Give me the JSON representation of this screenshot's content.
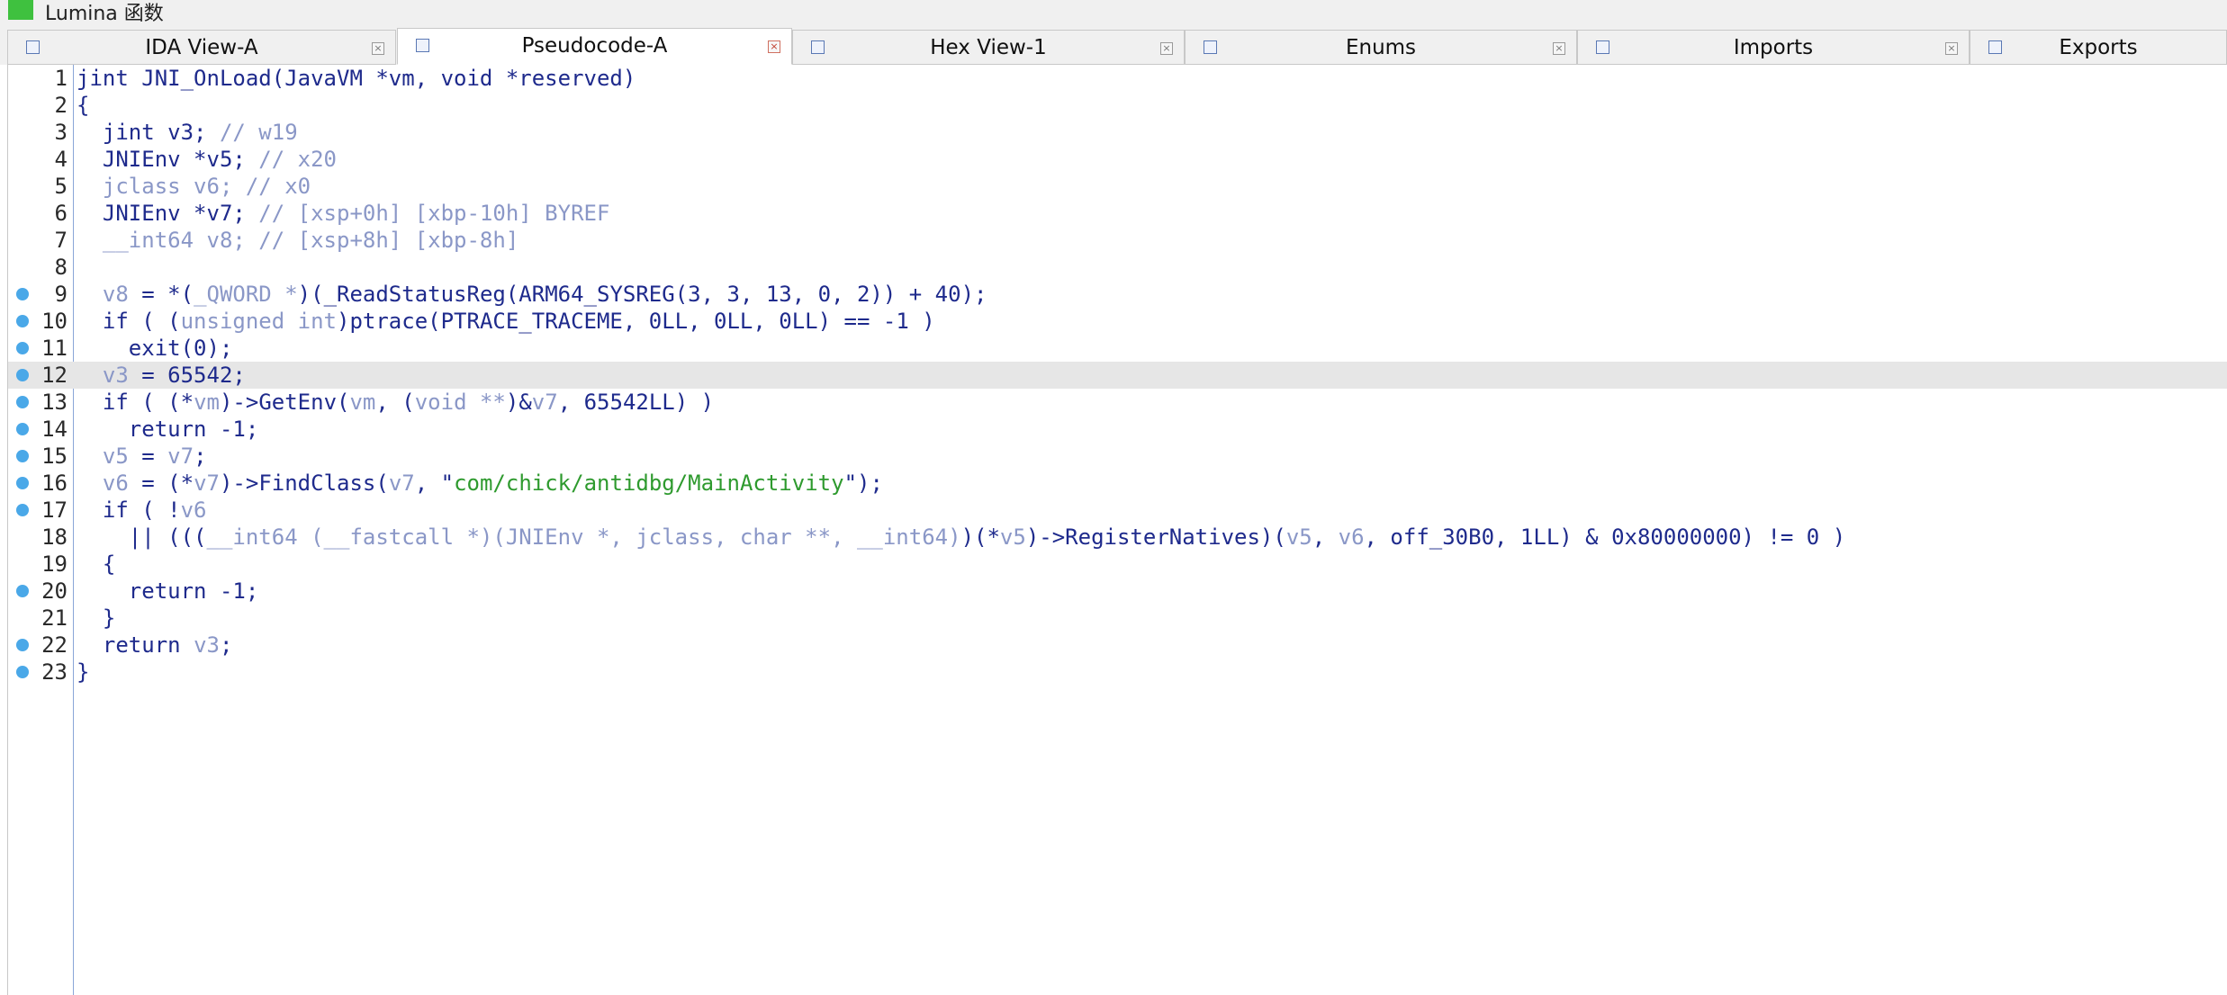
{
  "window": {
    "title": "Lumina 函数",
    "accent": "#3fc13f"
  },
  "tabs": [
    {
      "label": "IDA View-A",
      "icon": "ida-view-icon",
      "active": false
    },
    {
      "label": "Pseudocode-A",
      "icon": "pseudocode-icon",
      "active": true
    },
    {
      "label": "Hex View-1",
      "icon": "hex-view-icon",
      "active": false
    },
    {
      "label": "Enums",
      "icon": "enums-icon",
      "active": false
    },
    {
      "label": "Imports",
      "icon": "imports-icon",
      "active": false
    },
    {
      "label": "Exports",
      "icon": "exports-icon",
      "active": false
    }
  ],
  "close_glyph": "×",
  "editor": {
    "highlighted_line": 12,
    "lines": [
      {
        "n": "1",
        "bp": false,
        "indent": "",
        "parts": [
          [
            "p",
            "int JNI_OnLoad(JavaVM *vm, void *reserved)"
          ]
        ],
        "prefix": "j"
      },
      {
        "n": "2",
        "bp": false,
        "indent": "",
        "parts": [
          [
            "p",
            "{"
          ]
        ]
      },
      {
        "n": "3",
        "bp": false,
        "indent": "  ",
        "parts": [
          [
            "p",
            "jint v3; "
          ],
          [
            "c",
            "// w19"
          ]
        ]
      },
      {
        "n": "4",
        "bp": false,
        "indent": "  ",
        "parts": [
          [
            "p",
            "JNIEnv *v5; "
          ],
          [
            "c",
            "// x20"
          ]
        ]
      },
      {
        "n": "5",
        "bp": false,
        "indent": "  ",
        "parts": [
          [
            "v",
            "jclass v6; "
          ],
          [
            "c",
            "// x0"
          ]
        ]
      },
      {
        "n": "6",
        "bp": false,
        "indent": "  ",
        "parts": [
          [
            "p",
            "JNIEnv *v7; "
          ],
          [
            "c",
            "// [xsp+0h] [xbp-10h] BYREF"
          ]
        ]
      },
      {
        "n": "7",
        "bp": false,
        "indent": "  ",
        "parts": [
          [
            "v",
            "__int64 v8; "
          ],
          [
            "c",
            "// [xsp+8h] [xbp-8h]"
          ]
        ]
      },
      {
        "n": "8",
        "bp": false,
        "indent": "",
        "parts": []
      },
      {
        "n": "9",
        "bp": true,
        "indent": "  ",
        "parts": [
          [
            "v",
            "v8"
          ],
          [
            "p",
            " = *("
          ],
          [
            "v",
            "_QWORD *"
          ],
          [
            "p",
            ")("
          ],
          [
            "p",
            "_ReadStatusReg(ARM64_SYSREG(3, 3, 13, 0, 2)) + 40);"
          ]
        ]
      },
      {
        "n": "10",
        "bp": true,
        "indent": "  ",
        "parts": [
          [
            "p",
            "if ( ("
          ],
          [
            "v",
            "unsigned int"
          ],
          [
            "p",
            ")ptrace(PTRACE_TRACEME, 0LL, 0LL, 0LL) == -1 )"
          ]
        ]
      },
      {
        "n": "11",
        "bp": true,
        "indent": "    ",
        "parts": [
          [
            "p",
            "exit(0);"
          ]
        ]
      },
      {
        "n": "12",
        "bp": true,
        "indent": "  ",
        "parts": [
          [
            "v",
            "v3"
          ],
          [
            "p",
            " = 65542;"
          ]
        ]
      },
      {
        "n": "13",
        "bp": true,
        "indent": "  ",
        "parts": [
          [
            "p",
            "if ( (*"
          ],
          [
            "v",
            "vm"
          ],
          [
            "p",
            ")->GetEnv("
          ],
          [
            "v",
            "vm"
          ],
          [
            "p",
            ", ("
          ],
          [
            "v",
            "void **"
          ],
          [
            "p",
            ")&"
          ],
          [
            "v",
            "v7"
          ],
          [
            "p",
            ", 65542LL) )"
          ]
        ]
      },
      {
        "n": "14",
        "bp": true,
        "indent": "    ",
        "parts": [
          [
            "p",
            "return -1;"
          ]
        ]
      },
      {
        "n": "15",
        "bp": true,
        "indent": "  ",
        "parts": [
          [
            "v",
            "v5"
          ],
          [
            "p",
            " = "
          ],
          [
            "v",
            "v7"
          ],
          [
            "p",
            ";"
          ]
        ]
      },
      {
        "n": "16",
        "bp": true,
        "indent": "  ",
        "parts": [
          [
            "v",
            "v6"
          ],
          [
            "p",
            " = (*"
          ],
          [
            "v",
            "v7"
          ],
          [
            "p",
            ")->FindClass("
          ],
          [
            "v",
            "v7"
          ],
          [
            "p",
            ", \""
          ],
          [
            "s",
            "com/chick/antidbg/MainActivity"
          ],
          [
            "p",
            "\");"
          ]
        ]
      },
      {
        "n": "17",
        "bp": true,
        "indent": "  ",
        "parts": [
          [
            "p",
            "if ( !"
          ],
          [
            "v",
            "v6"
          ]
        ]
      },
      {
        "n": "18",
        "bp": false,
        "indent": "    ",
        "parts": [
          [
            "p",
            "|| ((("
          ],
          [
            "v",
            "__int64 (__fastcall *)(JNIEnv *, jclass, char **, __int64)"
          ],
          [
            "p",
            ")(*"
          ],
          [
            "v",
            "v5"
          ],
          [
            "p",
            ")->RegisterNatives)("
          ],
          [
            "v",
            "v5"
          ],
          [
            "p",
            ", "
          ],
          [
            "v",
            "v6"
          ],
          [
            "p",
            ", off_30B0, 1LL) & 0x80000000) != 0 )"
          ]
        ]
      },
      {
        "n": "19",
        "bp": false,
        "indent": "  ",
        "parts": [
          [
            "p",
            "{"
          ]
        ]
      },
      {
        "n": "20",
        "bp": true,
        "indent": "    ",
        "parts": [
          [
            "p",
            "return -1;"
          ]
        ]
      },
      {
        "n": "21",
        "bp": false,
        "indent": "  ",
        "parts": [
          [
            "p",
            "}"
          ]
        ]
      },
      {
        "n": "22",
        "bp": true,
        "indent": "  ",
        "parts": [
          [
            "p",
            "return "
          ],
          [
            "v",
            "v3"
          ],
          [
            "p",
            ";"
          ]
        ]
      },
      {
        "n": "23",
        "bp": true,
        "indent": "",
        "parts": [
          [
            "p",
            "}"
          ]
        ]
      }
    ]
  }
}
